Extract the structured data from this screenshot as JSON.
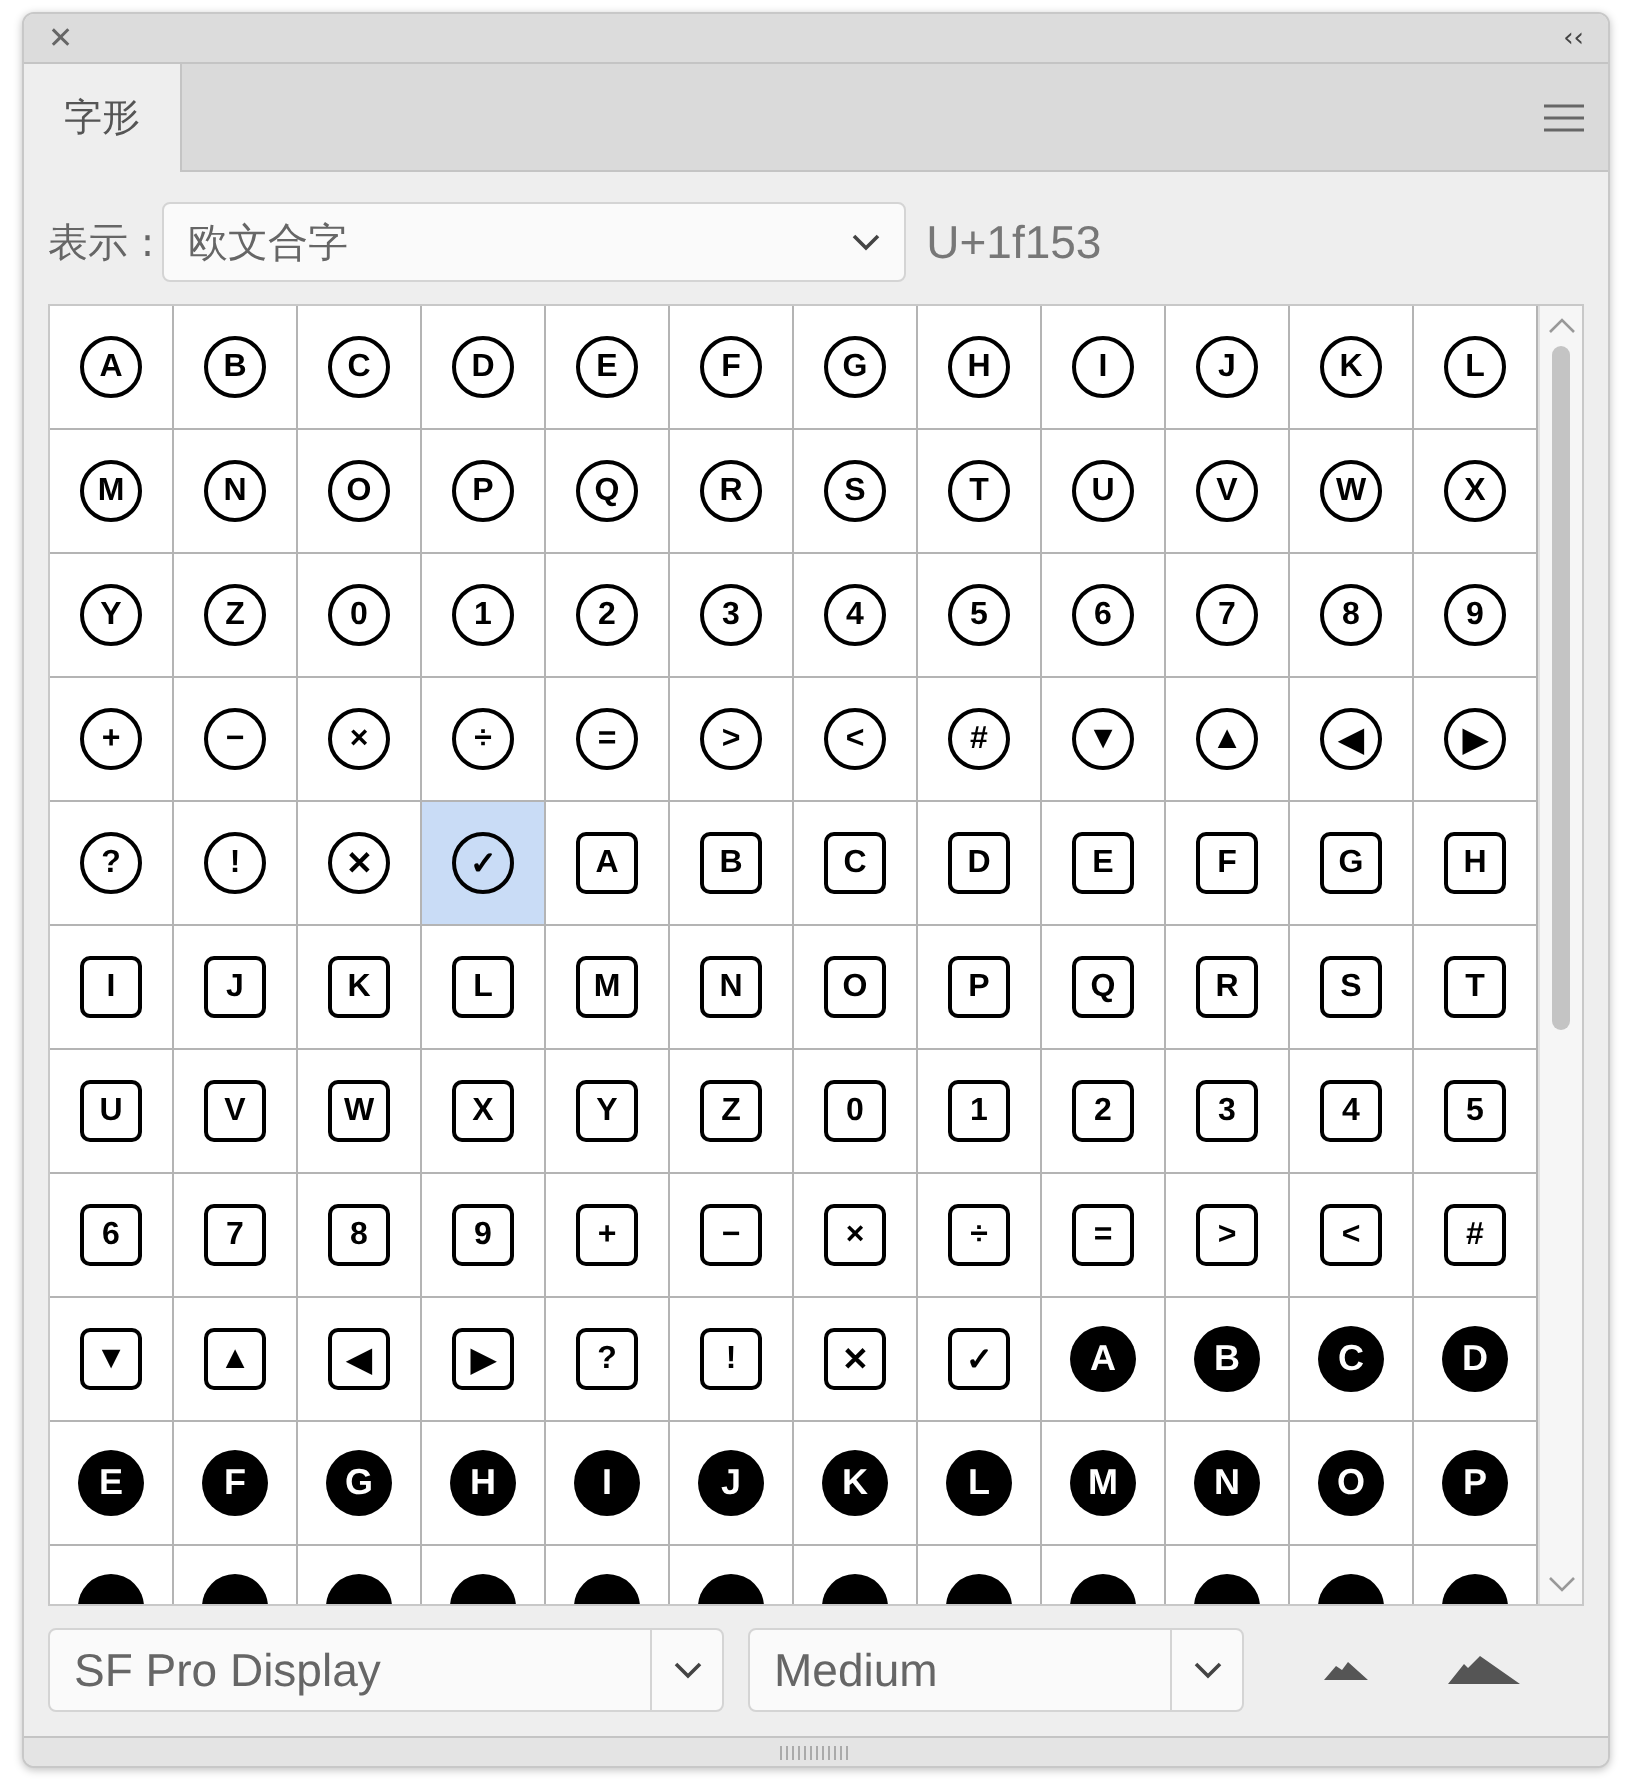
{
  "panel": {
    "close_icon": "✕",
    "collapse_icon": "‹‹"
  },
  "tabs": [
    {
      "label": "字形",
      "selected": true
    }
  ],
  "display": {
    "label": "表示 :",
    "value": "欧文合字",
    "code": "U+1f153"
  },
  "glyph_grid": {
    "rows": [
      [
        {
          "char": "A",
          "kind": "circled",
          "selected": false
        },
        {
          "char": "B",
          "kind": "circled",
          "selected": false
        },
        {
          "char": "C",
          "kind": "circled",
          "selected": false
        },
        {
          "char": "D",
          "kind": "circled",
          "selected": false
        },
        {
          "char": "E",
          "kind": "circled",
          "selected": false
        },
        {
          "char": "F",
          "kind": "circled",
          "selected": false
        },
        {
          "char": "G",
          "kind": "circled",
          "selected": false
        },
        {
          "char": "H",
          "kind": "circled",
          "selected": false
        },
        {
          "char": "I",
          "kind": "circled",
          "selected": false
        },
        {
          "char": "J",
          "kind": "circled",
          "selected": false
        },
        {
          "char": "K",
          "kind": "circled",
          "selected": false
        },
        {
          "char": "L",
          "kind": "circled",
          "selected": false
        }
      ],
      [
        {
          "char": "M",
          "kind": "circled",
          "selected": false
        },
        {
          "char": "N",
          "kind": "circled",
          "selected": false
        },
        {
          "char": "O",
          "kind": "circled",
          "selected": false
        },
        {
          "char": "P",
          "kind": "circled",
          "selected": false
        },
        {
          "char": "Q",
          "kind": "circled",
          "selected": false
        },
        {
          "char": "R",
          "kind": "circled",
          "selected": false
        },
        {
          "char": "S",
          "kind": "circled",
          "selected": false
        },
        {
          "char": "T",
          "kind": "circled",
          "selected": false
        },
        {
          "char": "U",
          "kind": "circled",
          "selected": false
        },
        {
          "char": "V",
          "kind": "circled",
          "selected": false
        },
        {
          "char": "W",
          "kind": "circled",
          "selected": false
        },
        {
          "char": "X",
          "kind": "circled",
          "selected": false
        }
      ],
      [
        {
          "char": "Y",
          "kind": "circled",
          "selected": false
        },
        {
          "char": "Z",
          "kind": "circled",
          "selected": false
        },
        {
          "char": "0",
          "kind": "circled",
          "selected": false
        },
        {
          "char": "1",
          "kind": "circled",
          "selected": false
        },
        {
          "char": "2",
          "kind": "circled",
          "selected": false
        },
        {
          "char": "3",
          "kind": "circled",
          "selected": false
        },
        {
          "char": "4",
          "kind": "circled",
          "selected": false
        },
        {
          "char": "5",
          "kind": "circled",
          "selected": false
        },
        {
          "char": "6",
          "kind": "circled",
          "selected": false
        },
        {
          "char": "7",
          "kind": "circled",
          "selected": false
        },
        {
          "char": "8",
          "kind": "circled",
          "selected": false
        },
        {
          "char": "9",
          "kind": "circled",
          "selected": false
        }
      ],
      [
        {
          "char": "+",
          "kind": "circled",
          "selected": false
        },
        {
          "char": "−",
          "kind": "circled",
          "selected": false
        },
        {
          "char": "×",
          "kind": "circled",
          "selected": false
        },
        {
          "char": "÷",
          "kind": "circled",
          "selected": false
        },
        {
          "char": "=",
          "kind": "circled",
          "selected": false
        },
        {
          "char": ">",
          "kind": "circled",
          "selected": false
        },
        {
          "char": "<",
          "kind": "circled",
          "selected": false
        },
        {
          "char": "#",
          "kind": "circled",
          "selected": false
        },
        {
          "char": "▼",
          "kind": "circled",
          "selected": false
        },
        {
          "char": "▲",
          "kind": "circled",
          "selected": false
        },
        {
          "char": "◀",
          "kind": "circled",
          "selected": false
        },
        {
          "char": "▶",
          "kind": "circled",
          "selected": false
        }
      ],
      [
        {
          "char": "?",
          "kind": "circled",
          "selected": false
        },
        {
          "char": "!",
          "kind": "circled",
          "selected": false
        },
        {
          "char": "✕",
          "kind": "circled",
          "selected": false
        },
        {
          "char": "✓",
          "kind": "circled",
          "selected": true
        },
        {
          "char": "A",
          "kind": "boxed",
          "selected": false
        },
        {
          "char": "B",
          "kind": "boxed",
          "selected": false
        },
        {
          "char": "C",
          "kind": "boxed",
          "selected": false
        },
        {
          "char": "D",
          "kind": "boxed",
          "selected": false
        },
        {
          "char": "E",
          "kind": "boxed",
          "selected": false
        },
        {
          "char": "F",
          "kind": "boxed",
          "selected": false
        },
        {
          "char": "G",
          "kind": "boxed",
          "selected": false
        },
        {
          "char": "H",
          "kind": "boxed",
          "selected": false
        }
      ],
      [
        {
          "char": "I",
          "kind": "boxed",
          "selected": false
        },
        {
          "char": "J",
          "kind": "boxed",
          "selected": false
        },
        {
          "char": "K",
          "kind": "boxed",
          "selected": false
        },
        {
          "char": "L",
          "kind": "boxed",
          "selected": false
        },
        {
          "char": "M",
          "kind": "boxed",
          "selected": false
        },
        {
          "char": "N",
          "kind": "boxed",
          "selected": false
        },
        {
          "char": "O",
          "kind": "boxed",
          "selected": false
        },
        {
          "char": "P",
          "kind": "boxed",
          "selected": false
        },
        {
          "char": "Q",
          "kind": "boxed",
          "selected": false
        },
        {
          "char": "R",
          "kind": "boxed",
          "selected": false
        },
        {
          "char": "S",
          "kind": "boxed",
          "selected": false
        },
        {
          "char": "T",
          "kind": "boxed",
          "selected": false
        }
      ],
      [
        {
          "char": "U",
          "kind": "boxed",
          "selected": false
        },
        {
          "char": "V",
          "kind": "boxed",
          "selected": false
        },
        {
          "char": "W",
          "kind": "boxed",
          "selected": false
        },
        {
          "char": "X",
          "kind": "boxed",
          "selected": false
        },
        {
          "char": "Y",
          "kind": "boxed",
          "selected": false
        },
        {
          "char": "Z",
          "kind": "boxed",
          "selected": false
        },
        {
          "char": "0",
          "kind": "boxed",
          "selected": false
        },
        {
          "char": "1",
          "kind": "boxed",
          "selected": false
        },
        {
          "char": "2",
          "kind": "boxed",
          "selected": false
        },
        {
          "char": "3",
          "kind": "boxed",
          "selected": false
        },
        {
          "char": "4",
          "kind": "boxed",
          "selected": false
        },
        {
          "char": "5",
          "kind": "boxed",
          "selected": false
        }
      ],
      [
        {
          "char": "6",
          "kind": "boxed",
          "selected": false
        },
        {
          "char": "7",
          "kind": "boxed",
          "selected": false
        },
        {
          "char": "8",
          "kind": "boxed",
          "selected": false
        },
        {
          "char": "9",
          "kind": "boxed",
          "selected": false
        },
        {
          "char": "+",
          "kind": "boxed",
          "selected": false
        },
        {
          "char": "−",
          "kind": "boxed",
          "selected": false
        },
        {
          "char": "×",
          "kind": "boxed",
          "selected": false
        },
        {
          "char": "÷",
          "kind": "boxed",
          "selected": false
        },
        {
          "char": "=",
          "kind": "boxed",
          "selected": false
        },
        {
          "char": ">",
          "kind": "boxed",
          "selected": false
        },
        {
          "char": "<",
          "kind": "boxed",
          "selected": false
        },
        {
          "char": "#",
          "kind": "boxed",
          "selected": false
        }
      ],
      [
        {
          "char": "▼",
          "kind": "boxed",
          "selected": false
        },
        {
          "char": "▲",
          "kind": "boxed",
          "selected": false
        },
        {
          "char": "◀",
          "kind": "boxed",
          "selected": false
        },
        {
          "char": "▶",
          "kind": "boxed",
          "selected": false
        },
        {
          "char": "?",
          "kind": "boxed",
          "selected": false
        },
        {
          "char": "!",
          "kind": "boxed",
          "selected": false
        },
        {
          "char": "✕",
          "kind": "boxed",
          "selected": false
        },
        {
          "char": "✓",
          "kind": "boxed",
          "selected": false
        },
        {
          "char": "A",
          "kind": "filled",
          "selected": false
        },
        {
          "char": "B",
          "kind": "filled",
          "selected": false
        },
        {
          "char": "C",
          "kind": "filled",
          "selected": false
        },
        {
          "char": "D",
          "kind": "filled",
          "selected": false
        }
      ],
      [
        {
          "char": "E",
          "kind": "filled",
          "selected": false
        },
        {
          "char": "F",
          "kind": "filled",
          "selected": false
        },
        {
          "char": "G",
          "kind": "filled",
          "selected": false
        },
        {
          "char": "H",
          "kind": "filled",
          "selected": false
        },
        {
          "char": "I",
          "kind": "filled",
          "selected": false
        },
        {
          "char": "J",
          "kind": "filled",
          "selected": false
        },
        {
          "char": "K",
          "kind": "filled",
          "selected": false
        },
        {
          "char": "L",
          "kind": "filled",
          "selected": false
        },
        {
          "char": "M",
          "kind": "filled",
          "selected": false
        },
        {
          "char": "N",
          "kind": "filled",
          "selected": false
        },
        {
          "char": "O",
          "kind": "filled",
          "selected": false
        },
        {
          "char": "P",
          "kind": "filled",
          "selected": false
        }
      ],
      [
        {
          "kind": "filled",
          "selected": false
        },
        {
          "kind": "filled",
          "selected": false
        },
        {
          "kind": "filled",
          "selected": false
        },
        {
          "kind": "filled",
          "selected": false
        },
        {
          "kind": "filled",
          "selected": false
        },
        {
          "kind": "filled",
          "selected": false
        },
        {
          "kind": "filled",
          "selected": false
        },
        {
          "kind": "filled",
          "selected": false
        },
        {
          "kind": "filled",
          "selected": false
        },
        {
          "kind": "filled",
          "selected": false
        },
        {
          "kind": "filled",
          "selected": false
        },
        {
          "kind": "filled",
          "selected": false
        }
      ]
    ]
  },
  "font": {
    "family": "SF Pro Display",
    "style": "Medium"
  }
}
